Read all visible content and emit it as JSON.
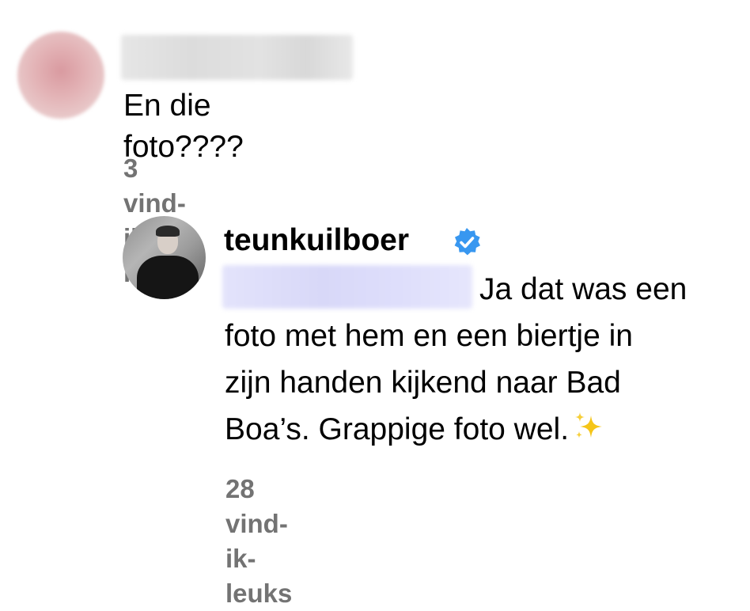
{
  "comment": {
    "text": "En die foto????",
    "likes": "3 vind-ik-leuks"
  },
  "reply": {
    "username": "teunkuilboer",
    "line1": "Ja dat was een",
    "line2": "foto met hem en een biertje in",
    "line3": "zijn handen kijkend naar Bad",
    "line4": "Boa’s. Grappige foto wel.",
    "likes": "28 vind-ik-leuks"
  },
  "icons": {
    "verified": "verified-badge-icon",
    "sparkles": "sparkles-emoji"
  },
  "colors": {
    "verified_blue": "#3897f0",
    "meta_gray": "#737373",
    "sparkle_gold": "#f5c518"
  }
}
